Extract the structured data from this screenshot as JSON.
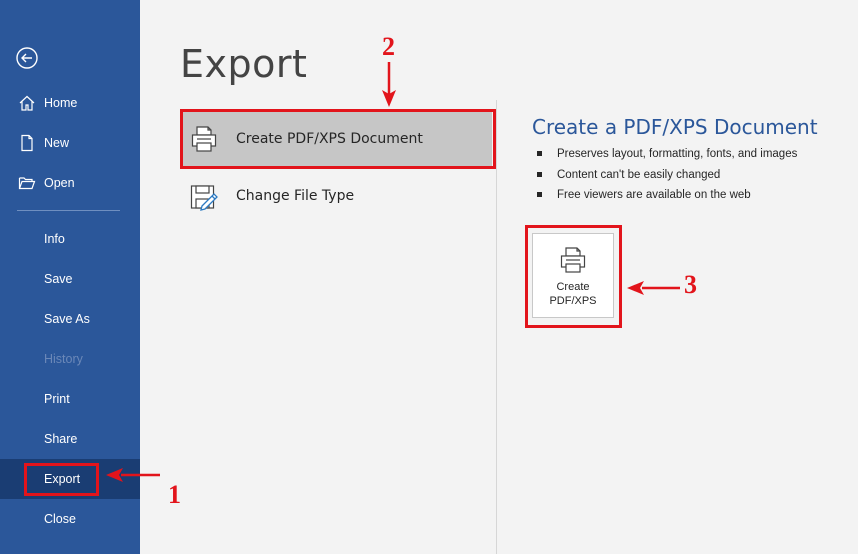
{
  "sidebar": {
    "back_icon": "back-arrow-circle-icon",
    "items": [
      {
        "label": "Home",
        "icon": "home-icon"
      },
      {
        "label": "New",
        "icon": "new-document-icon"
      },
      {
        "label": "Open",
        "icon": "folder-open-icon"
      },
      {
        "label": "Info"
      },
      {
        "label": "Save"
      },
      {
        "label": "Save As"
      },
      {
        "label": "History",
        "state": "disabled"
      },
      {
        "label": "Print"
      },
      {
        "label": "Share"
      },
      {
        "label": "Export",
        "state": "selected"
      },
      {
        "label": "Close"
      }
    ]
  },
  "main": {
    "title": "Export",
    "options": [
      {
        "label": "Create PDF/XPS Document",
        "icon": "pdf-printer-icon",
        "state": "selected"
      },
      {
        "label": "Change File Type",
        "icon": "change-file-type-icon"
      }
    ],
    "detail": {
      "title": "Create a PDF/XPS Document",
      "bullets": [
        "Preserves layout, formatting, fonts, and images",
        "Content can't be easily changed",
        "Free viewers are available on the web"
      ],
      "button_label": "Create PDF/XPS",
      "button_icon": "pdf-printer-icon"
    }
  },
  "annotations": {
    "step1": "1",
    "step2": "2",
    "step3": "3",
    "color": "#e2141b"
  },
  "colors": {
    "sidebar": "#2b579a",
    "sidebar_selected": "#1a3d73",
    "accent_text": "#2b579a",
    "background": "#f3f3f3"
  }
}
